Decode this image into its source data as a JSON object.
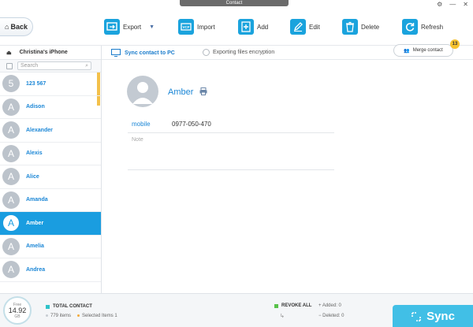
{
  "window": {
    "title": "Contact"
  },
  "toolbar": {
    "back_label": "Back",
    "export_label": "Export",
    "import_label": "Import",
    "add_label": "Add",
    "edit_label": "Edit",
    "delete_label": "Delete",
    "refresh_label": "Refresh",
    "import_badge": "VCF"
  },
  "sidebar": {
    "device_name": "Christina's iPhone",
    "search_placeholder": "Search",
    "contacts": [
      {
        "letter": "5",
        "name": "123 567"
      },
      {
        "letter": "A",
        "name": "Adison"
      },
      {
        "letter": "A",
        "name": "Alexander"
      },
      {
        "letter": "A",
        "name": "Alexis"
      },
      {
        "letter": "A",
        "name": "Alice"
      },
      {
        "letter": "A",
        "name": "Amanda"
      },
      {
        "letter": "A",
        "name": "Amber"
      },
      {
        "letter": "A",
        "name": "Amelia"
      },
      {
        "letter": "A",
        "name": "Andrea"
      }
    ]
  },
  "subbar": {
    "sync_to_pc": "Sync contact to PC",
    "encryption": "Exporting files encryption",
    "merge_label": "Merge contact",
    "merge_count": "13"
  },
  "detail": {
    "name": "Amber",
    "field_label": "mobile",
    "field_value": "0977-050-470",
    "note_placeholder": "Note"
  },
  "bottom": {
    "free_label": "Free",
    "free_value": "14.92",
    "free_unit": "GB",
    "total_label": "TOTAL CONTACT",
    "items": "779 items",
    "selected": "Selected Items 1",
    "revoke_label": "REVOKE ALL",
    "added": "Added: 0",
    "deleted": "Deleted: 0",
    "sync_label": "Sync"
  },
  "colors": {
    "accent": "#1a9de0",
    "toolbar_icon": "#1aa3dd",
    "sync_button": "#41bfe6",
    "total_square": "#2fc3c9",
    "revoke_square": "#58c24a",
    "selected_dot": "#f3a93a"
  }
}
